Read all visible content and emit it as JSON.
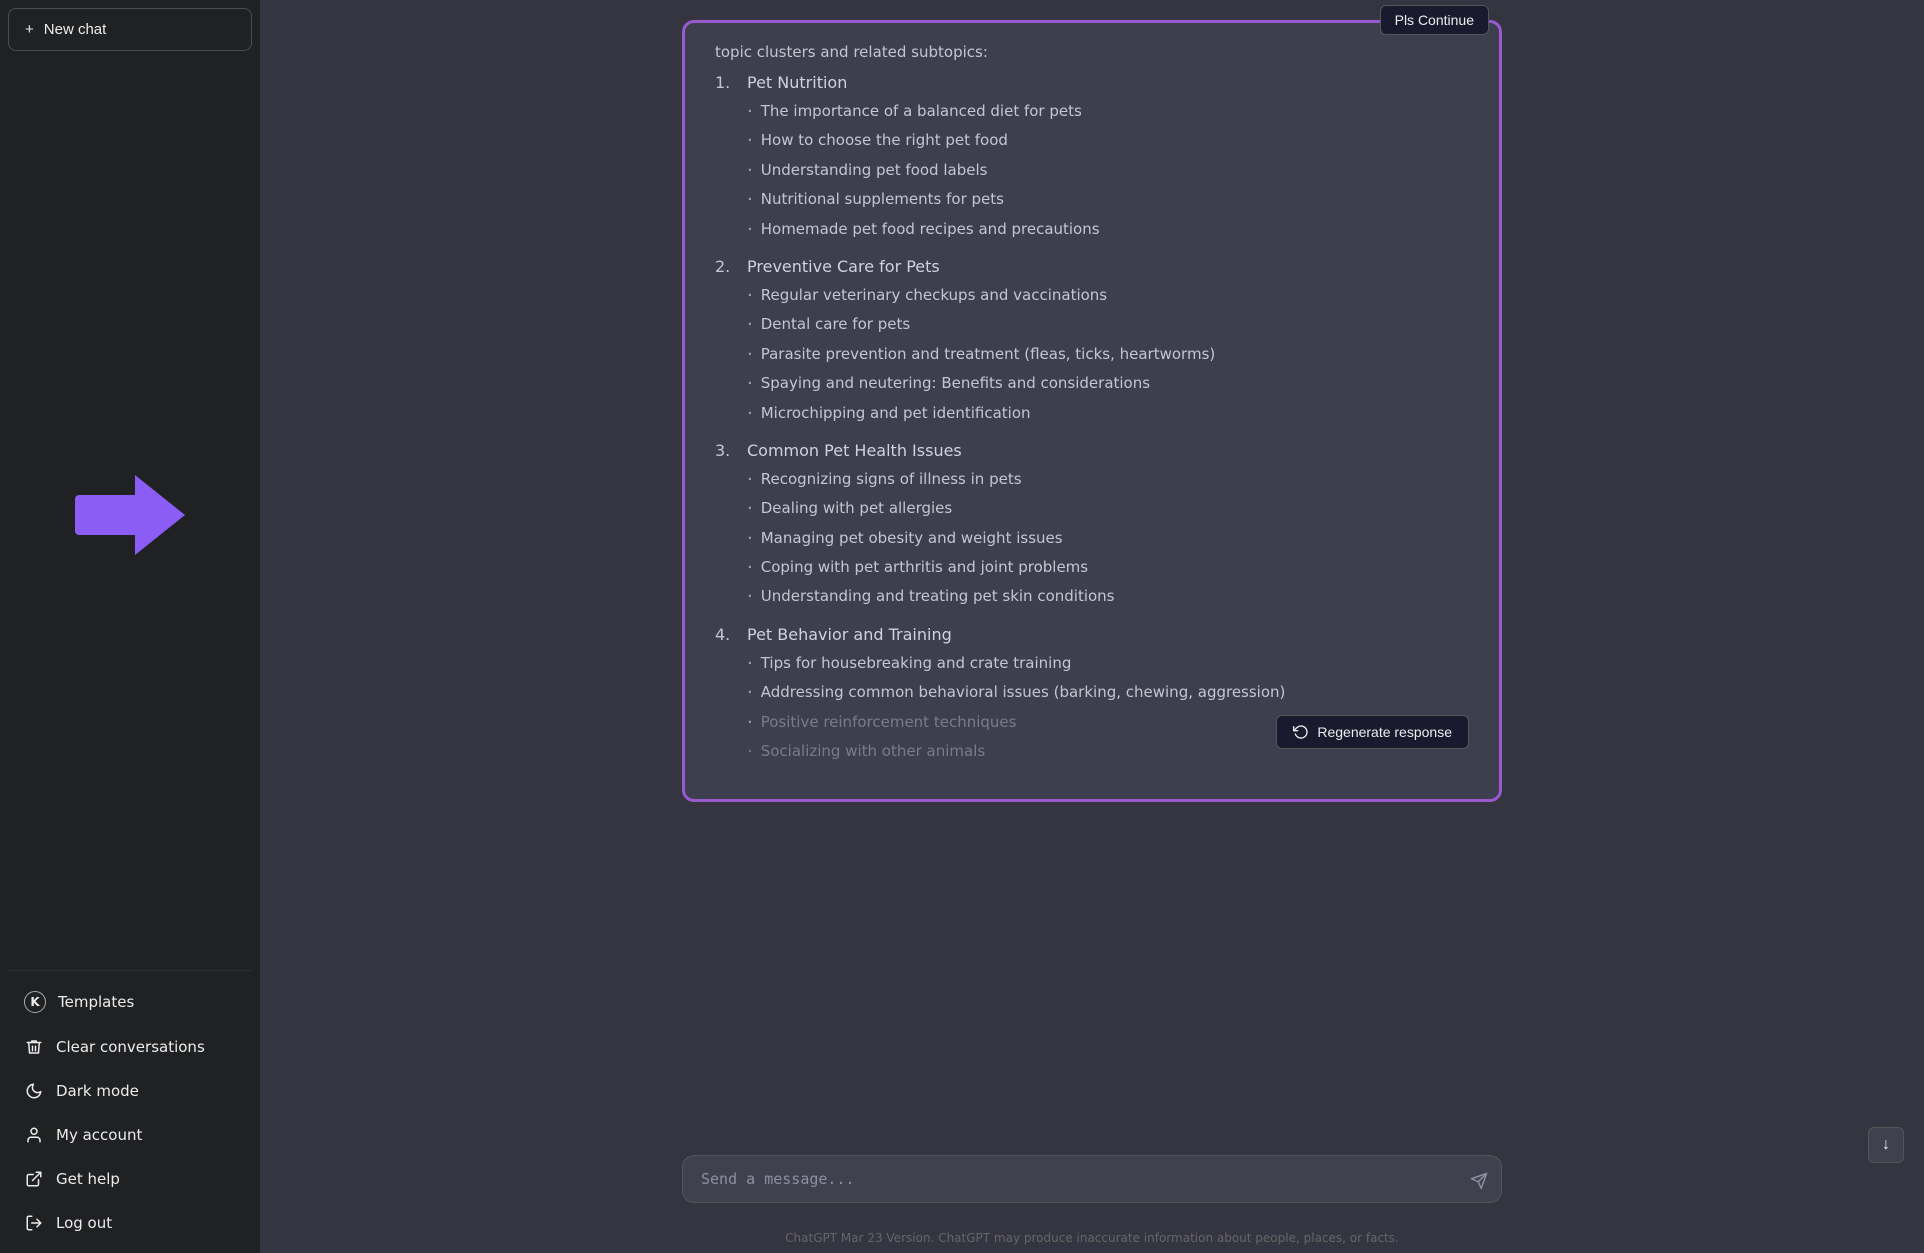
{
  "sidebar": {
    "new_chat_label": "New chat",
    "new_chat_plus": "+",
    "items": [
      {
        "id": "templates",
        "label": "Templates",
        "icon": "K"
      },
      {
        "id": "clear-conversations",
        "label": "Clear conversations",
        "icon": "trash"
      },
      {
        "id": "dark-mode",
        "label": "Dark mode",
        "icon": "moon"
      },
      {
        "id": "my-account",
        "label": "My account",
        "icon": "person"
      },
      {
        "id": "get-help",
        "label": "Get help",
        "icon": "external-link"
      },
      {
        "id": "log-out",
        "label": "Log out",
        "icon": "logout"
      }
    ]
  },
  "chat": {
    "partial_header": "topic clusters and related subtopics:",
    "pls_continue_label": "Pls Continue",
    "sections": [
      {
        "number": "1.",
        "title": "Pet Nutrition",
        "subtopics": [
          "The importance of a balanced diet for pets",
          "How to choose the right pet food",
          "Understanding pet food labels",
          "Nutritional supplements for pets",
          "Homemade pet food recipes and precautions"
        ]
      },
      {
        "number": "2.",
        "title": "Preventive Care for Pets",
        "subtopics": [
          "Regular veterinary checkups and vaccinations",
          "Dental care for pets",
          "Parasite prevention and treatment (fleas, ticks, heartworms)",
          "Spaying and neutering: Benefits and considerations",
          "Microchipping and pet identification"
        ]
      },
      {
        "number": "3.",
        "title": "Common Pet Health Issues",
        "subtopics": [
          "Recognizing signs of illness in pets",
          "Dealing with pet allergies",
          "Managing pet obesity and weight issues",
          "Coping with pet arthritis and joint problems",
          "Understanding and treating pet skin conditions"
        ]
      },
      {
        "number": "4.",
        "title": "Pet Behavior and Training",
        "subtopics": [
          "Tips for housebreaking and crate training",
          "Addressing common behavioral issues (barking, chewing, aggression)",
          "Positive reinforcement techniques",
          "Socializing with other animals"
        ]
      }
    ],
    "faded_subtopics_count": 2,
    "input_placeholder": "Send a message...",
    "regenerate_label": "Regenerate response",
    "scroll_down_icon": "↓",
    "footer_text": "ChatGPT Mar 23 Version. ChatGPT may produce inaccurate information about people, places, or facts."
  }
}
